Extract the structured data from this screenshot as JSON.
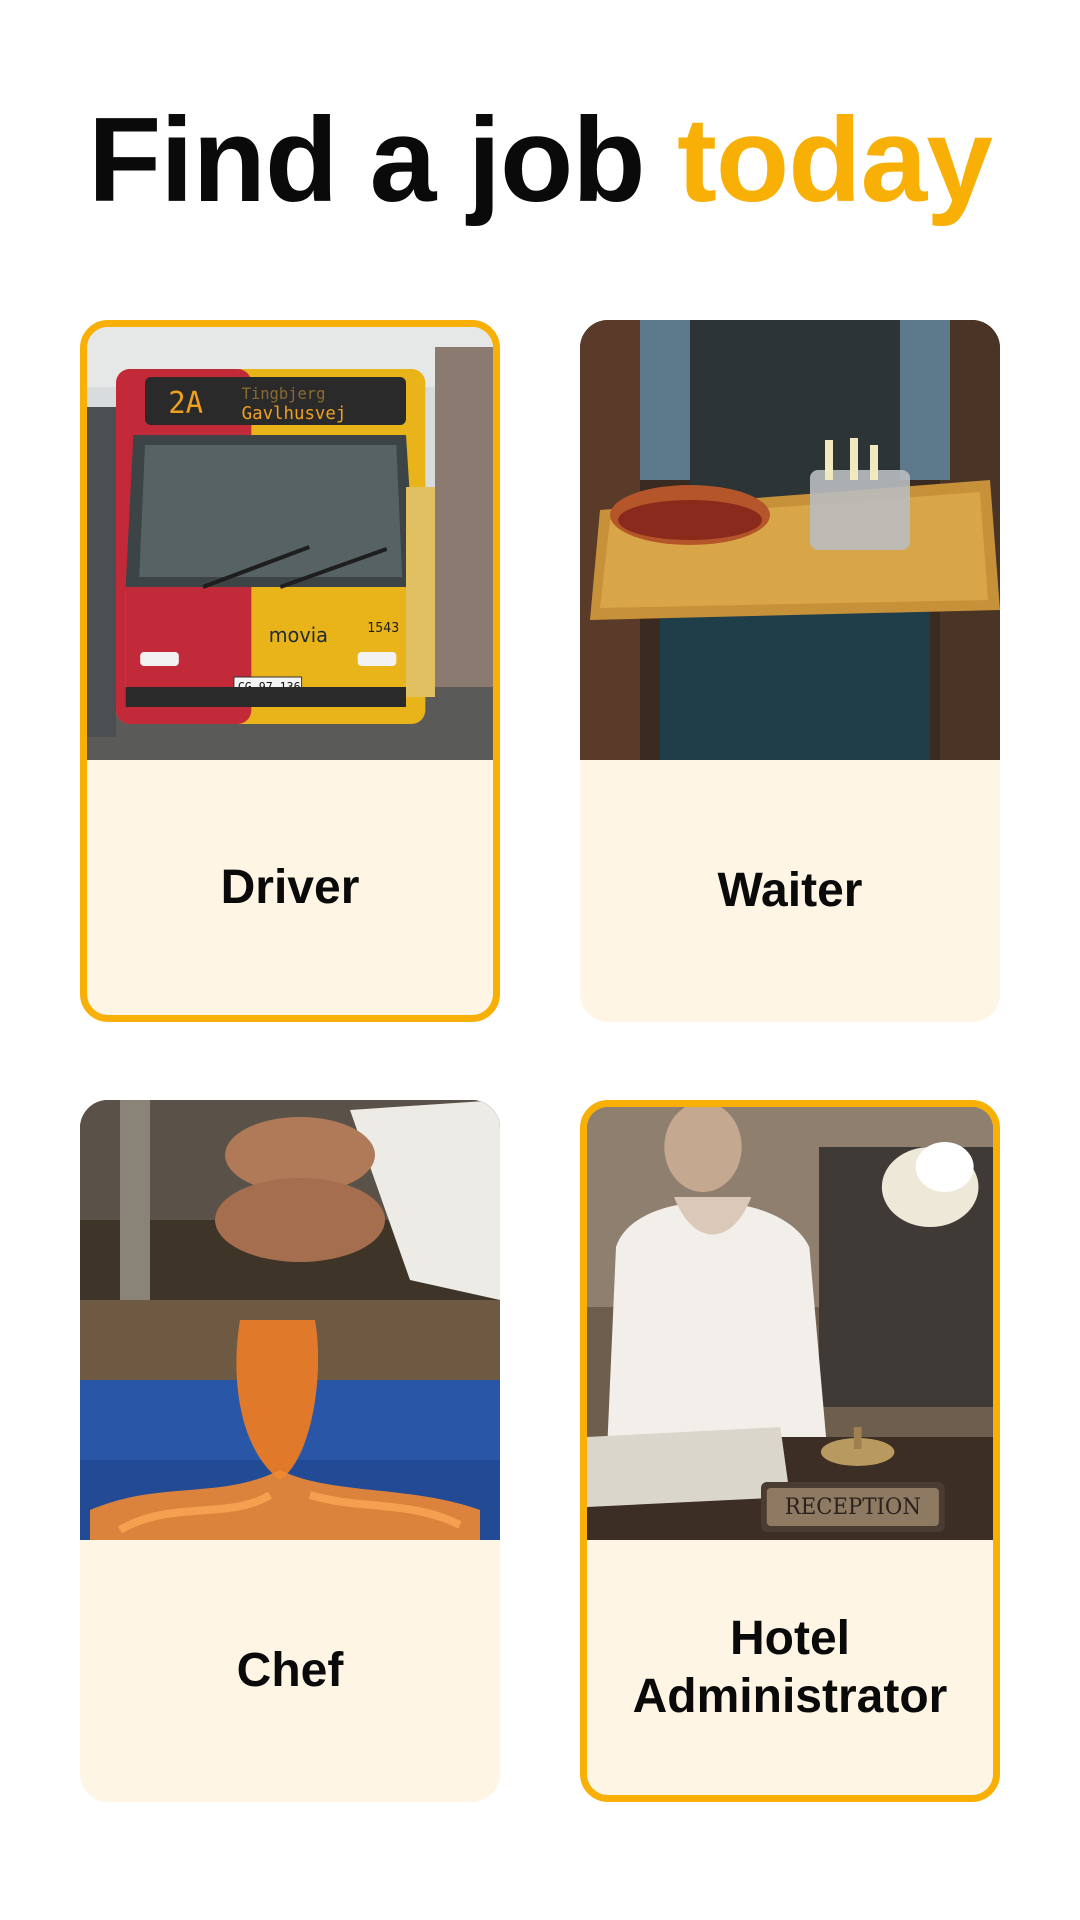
{
  "header": {
    "title_main": "Find a job",
    "title_accent": "today",
    "accent_color": "#f8b007"
  },
  "jobs": [
    {
      "label": "Driver",
      "selected": true,
      "image": "city-bus-photo"
    },
    {
      "label": "Waiter",
      "selected": false,
      "image": "waiter-serving-food-photo"
    },
    {
      "label": "Chef",
      "selected": false,
      "image": "chef-peeling-carrot-photo"
    },
    {
      "label": "Hotel Administrator",
      "selected": true,
      "image": "hotel-reception-photo"
    }
  ],
  "bus": {
    "route": "2A",
    "destination_top": "Tingbjerg",
    "destination": "Gavlhusvej",
    "brand": "movia",
    "fleet_number": "1543",
    "plate": "CG 97 136"
  },
  "reception_sign": "RECEPTION",
  "colors": {
    "card_background": "#fef5e4",
    "selected_border": "#f8b007"
  }
}
